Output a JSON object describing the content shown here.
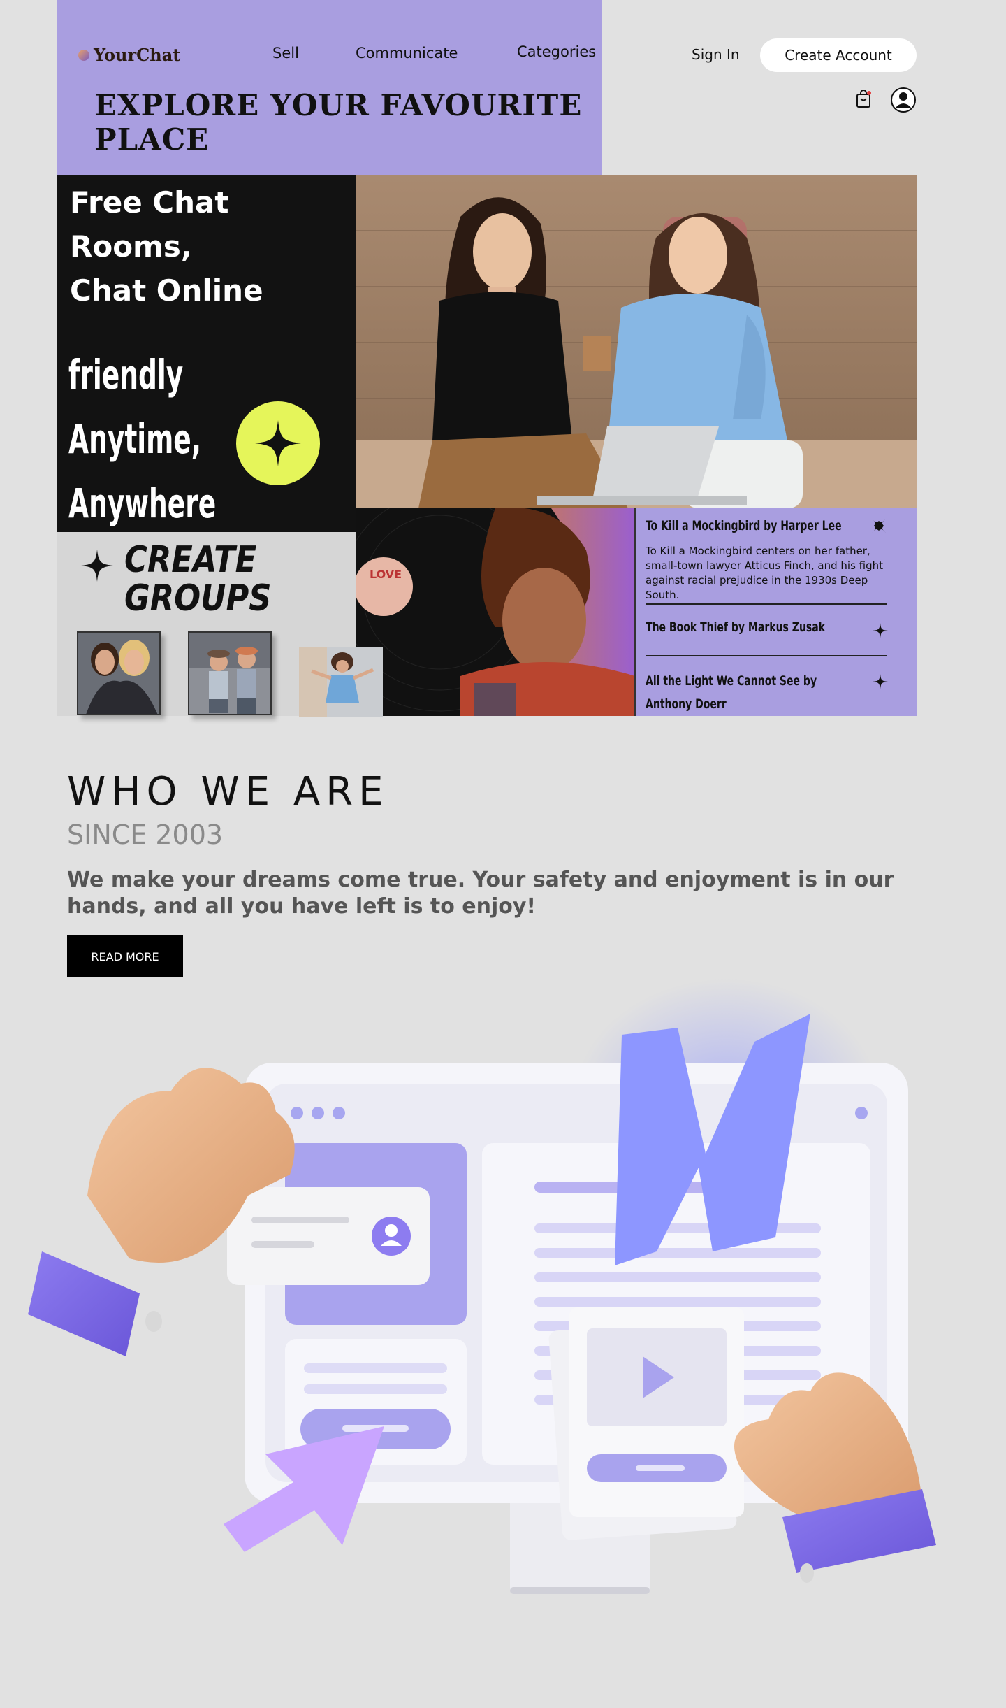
{
  "header": {
    "logo_text": "YourChat",
    "nav": [
      "Sell",
      "Communicate",
      "Categories"
    ],
    "sign_in": "Sign In",
    "create_account": "Create Account",
    "headline": "EXPLORE YOUR FAVOURITE PLACE"
  },
  "hero": {
    "title_lines": [
      "Free Chat",
      "Rooms,",
      "Chat Online"
    ],
    "tagline_lines": [
      "friendly",
      "Anytime,",
      "Anywhere"
    ],
    "groups_lines": [
      "CREATE",
      "GROUPS"
    ],
    "vinyl_label": "LOVE"
  },
  "books": [
    {
      "title": "To Kill a Mockingbird by Harper Lee",
      "description": "To Kill a Mockingbird centers on her father, small-town lawyer Atticus Finch, and his fight against racial prejudice in the 1930s Deep South."
    },
    {
      "title": "The Book Thief by Markus Zusak"
    },
    {
      "title": "All the Light We Cannot See by Anthony Doerr"
    }
  ],
  "about": {
    "heading": "WHO WE ARE",
    "since": "SINCE 2003",
    "text": "We make your dreams come true. Your safety and enjoyment is in our hands, and all you have left is to enjoy!",
    "read_more": "READ MORE"
  },
  "colors": {
    "accent_purple": "#a99ee0",
    "lime": "#e5f55a",
    "panel_black": "#121212",
    "page_bg": "#e1e1e1"
  },
  "icons": [
    "cart-icon",
    "user-icon",
    "sparkle-icon",
    "close-star-icon"
  ]
}
